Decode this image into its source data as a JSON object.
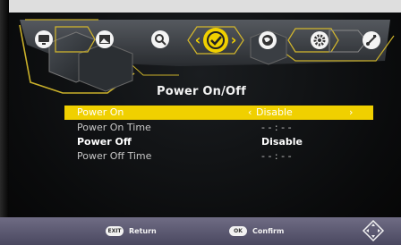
{
  "header": {
    "icons": [
      {
        "name": "screen-icon"
      },
      {
        "name": "picture-icon"
      },
      {
        "name": "search-icon"
      },
      {
        "name": "clock-check-icon",
        "selected": true
      },
      {
        "name": "globe-icon"
      },
      {
        "name": "gear-icon"
      },
      {
        "name": "usb-icon"
      }
    ],
    "nav_left": "‹",
    "nav_right": "›"
  },
  "page": {
    "title": "Power On/Off"
  },
  "menu": {
    "items": [
      {
        "label": "Power On",
        "value": "Disable",
        "selected": true
      },
      {
        "label": "Power On Time",
        "value": "- - : - -"
      },
      {
        "label": "Power Off",
        "value": "Disable"
      },
      {
        "label": "Power Off Time",
        "value": "- - : - -"
      }
    ]
  },
  "footer": {
    "return_label": "Return",
    "return_key": "EXIT",
    "confirm_label": "Confirm",
    "confirm_key": "OK"
  },
  "colors": {
    "accent": "#f0d000",
    "footer": "#5a5873",
    "background": "#0b0c0d"
  }
}
